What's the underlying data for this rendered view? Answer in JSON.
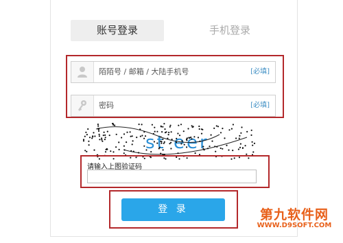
{
  "tabs": [
    {
      "label": "账号登录",
      "active": true
    },
    {
      "label": "手机登录",
      "active": false
    }
  ],
  "fields": {
    "account": {
      "placeholder": "陌陌号 / 邮箱 / 大陆手机号",
      "required_label": "[必填]",
      "icon": "user-icon"
    },
    "password": {
      "placeholder": "密码",
      "required_label": "[必填]",
      "icon": "key-icon"
    }
  },
  "captcha": {
    "text": "st eer",
    "label": "请输入上图验证码",
    "value": ""
  },
  "login_button": {
    "label": "登 录"
  },
  "watermark": {
    "main": "第九软件网",
    "sub": "WWW.D9SOFT.COM"
  },
  "colors": {
    "highlight": "#b3272a",
    "accent": "#2aa6e9",
    "required_text": "#3f8fc4"
  }
}
